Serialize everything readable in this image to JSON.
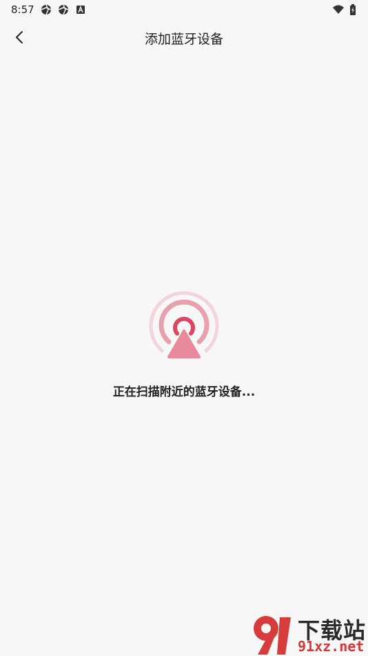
{
  "status_bar": {
    "time": "8:57",
    "left_icons": [
      "aperture-icon",
      "aperture-icon",
      "font-a-icon"
    ],
    "right_icons": [
      "wifi-icon",
      "battery-charging-icon"
    ]
  },
  "header": {
    "back_icon": "chevron-left-icon",
    "title": "添加蓝牙设备"
  },
  "scan": {
    "radar_icon": "radar-broadcast-icon",
    "status_text": "正在扫描附近的蓝牙设备..."
  },
  "watermark": {
    "top_text": "下载站",
    "bottom_text": "91xz.net"
  },
  "colors": {
    "background": "#f7f7f7",
    "accent": "#e05070",
    "accent_light": "#f0c8d0",
    "accent_mid": "#e08898"
  }
}
